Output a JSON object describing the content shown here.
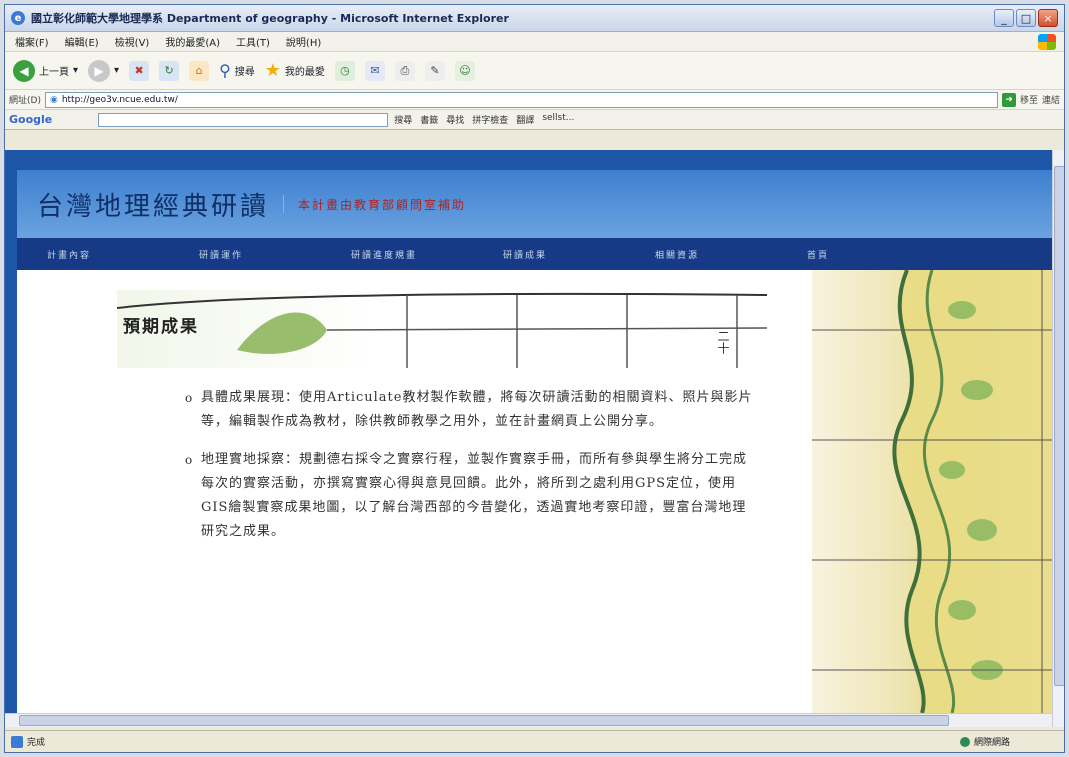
{
  "window": {
    "title": "國立彰化師範大學地理學系 Department of geography - Microsoft Internet Explorer",
    "controls": [
      "_",
      "□",
      "×"
    ]
  },
  "menu": [
    "檔案(F)",
    "編輯(E)",
    "檢視(V)",
    "我的最愛(A)",
    "工具(T)",
    "說明(H)"
  ],
  "toolbar": {
    "back": "上一頁",
    "search": "搜尋",
    "favorites": "我的最愛"
  },
  "address": {
    "label": "網址(D)",
    "url": "http://geo3v.ncue.edu.tw/",
    "go": "移至",
    "links": "連結"
  },
  "googlebar": {
    "logo": "Google",
    "items": [
      "搜尋",
      "書籤",
      "尋找",
      "拼字檢查",
      "翻譯",
      "sellst..."
    ]
  },
  "site": {
    "title": "台灣地理經典研讀",
    "subtitle": "本計畫由教育部顧問室補助",
    "nav": [
      "計畫內容",
      "研讀運作",
      "研讀進度規畫",
      "研讀成果",
      "相關資源",
      "首頁"
    ],
    "heading": "預期成果",
    "bullets": [
      "具體成果展現：使用Articulate教材製作軟體，將每次研讀活動的相關資料、照片與影片等，編輯製作成為教材，除供教師教學之用外，並在計畫網頁上公開分享。",
      "地理實地採察：規劃德右採令之實察行程，並製作實察手冊，而所有參與學生將分工完成每次的實察活動，亦撰寫實察心得與意見回饋。此外，將所到之處利用GPS定位，使用GIS繪製實察成果地圖，以了解台灣西部的今昔變化，透過實地考察印證，豐富台灣地理研究之成果。"
    ],
    "map_numeral": "二十"
  },
  "status": {
    "text": "完成",
    "zone": "網際網路"
  },
  "colors": {
    "banner": "#3e7fcf",
    "navbar": "#173a86",
    "subtitle": "#b22222"
  }
}
